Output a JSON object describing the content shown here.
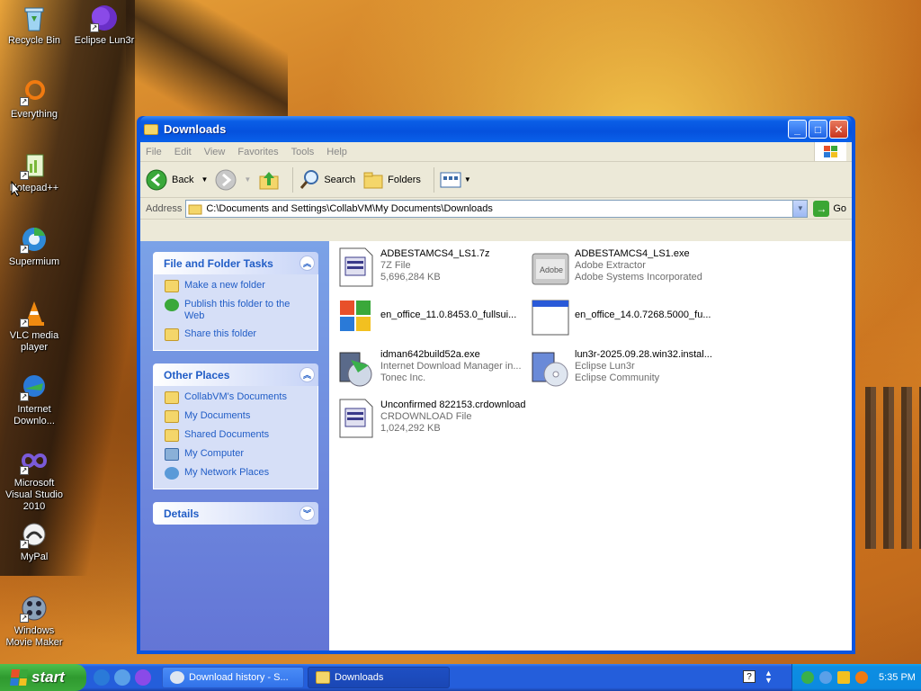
{
  "desktop": {
    "icons": [
      {
        "label": "Recycle Bin"
      },
      {
        "label": "Eclipse Lun3r"
      },
      {
        "label": "Everything"
      },
      {
        "label": "Notepad++"
      },
      {
        "label": "Supermium"
      },
      {
        "label": "VLC media player"
      },
      {
        "label": "Internet Downlo..."
      },
      {
        "label": "Microsoft Visual Studio 2010"
      },
      {
        "label": "MyPal"
      },
      {
        "label": "Windows Movie Maker"
      }
    ]
  },
  "window": {
    "title": "Downloads",
    "menu": [
      "File",
      "Edit",
      "View",
      "Favorites",
      "Tools",
      "Help"
    ],
    "toolbar": {
      "back": "Back",
      "search": "Search",
      "folders": "Folders"
    },
    "address": {
      "label": "Address",
      "path": "C:\\Documents and Settings\\CollabVM\\My Documents\\Downloads",
      "go": "Go"
    },
    "taskpane": {
      "file_tasks": {
        "title": "File and Folder Tasks",
        "items": [
          "Make a new folder",
          "Publish this folder to the Web",
          "Share this folder"
        ]
      },
      "other_places": {
        "title": "Other Places",
        "items": [
          "CollabVM's Documents",
          "My Documents",
          "Shared Documents",
          "My Computer",
          "My Network Places"
        ]
      },
      "details": {
        "title": "Details"
      }
    },
    "files": [
      {
        "name": "ADBESTAMCS4_LS1.7z",
        "line2": "7Z File",
        "line3": "5,696,284 KB"
      },
      {
        "name": "ADBESTAMCS4_LS1.exe",
        "line2": "Adobe Extractor",
        "line3": "Adobe Systems Incorporated"
      },
      {
        "name": "en_office_11.0.8453.0_fullsui...",
        "line2": "",
        "line3": ""
      },
      {
        "name": "en_office_14.0.7268.5000_fu...",
        "line2": "",
        "line3": ""
      },
      {
        "name": "idman642build52a.exe",
        "line2": "Internet Download Manager in...",
        "line3": "Tonec Inc."
      },
      {
        "name": "lun3r-2025.09.28.win32.instal...",
        "line2": "Eclipse Lun3r",
        "line3": "Eclipse Community"
      },
      {
        "name": "Unconfirmed 822153.crdownload",
        "line2": "CRDOWNLOAD File",
        "line3": "1,024,292 KB"
      }
    ]
  },
  "taskbar": {
    "start": "start",
    "tasks": [
      "Download history - S...",
      "Downloads"
    ],
    "clock": "5:35 PM"
  },
  "colors": {
    "link": "#215dc6",
    "titlebar": "#0551dd",
    "taskbar": "#245edb",
    "start": "#2f9a2f"
  }
}
